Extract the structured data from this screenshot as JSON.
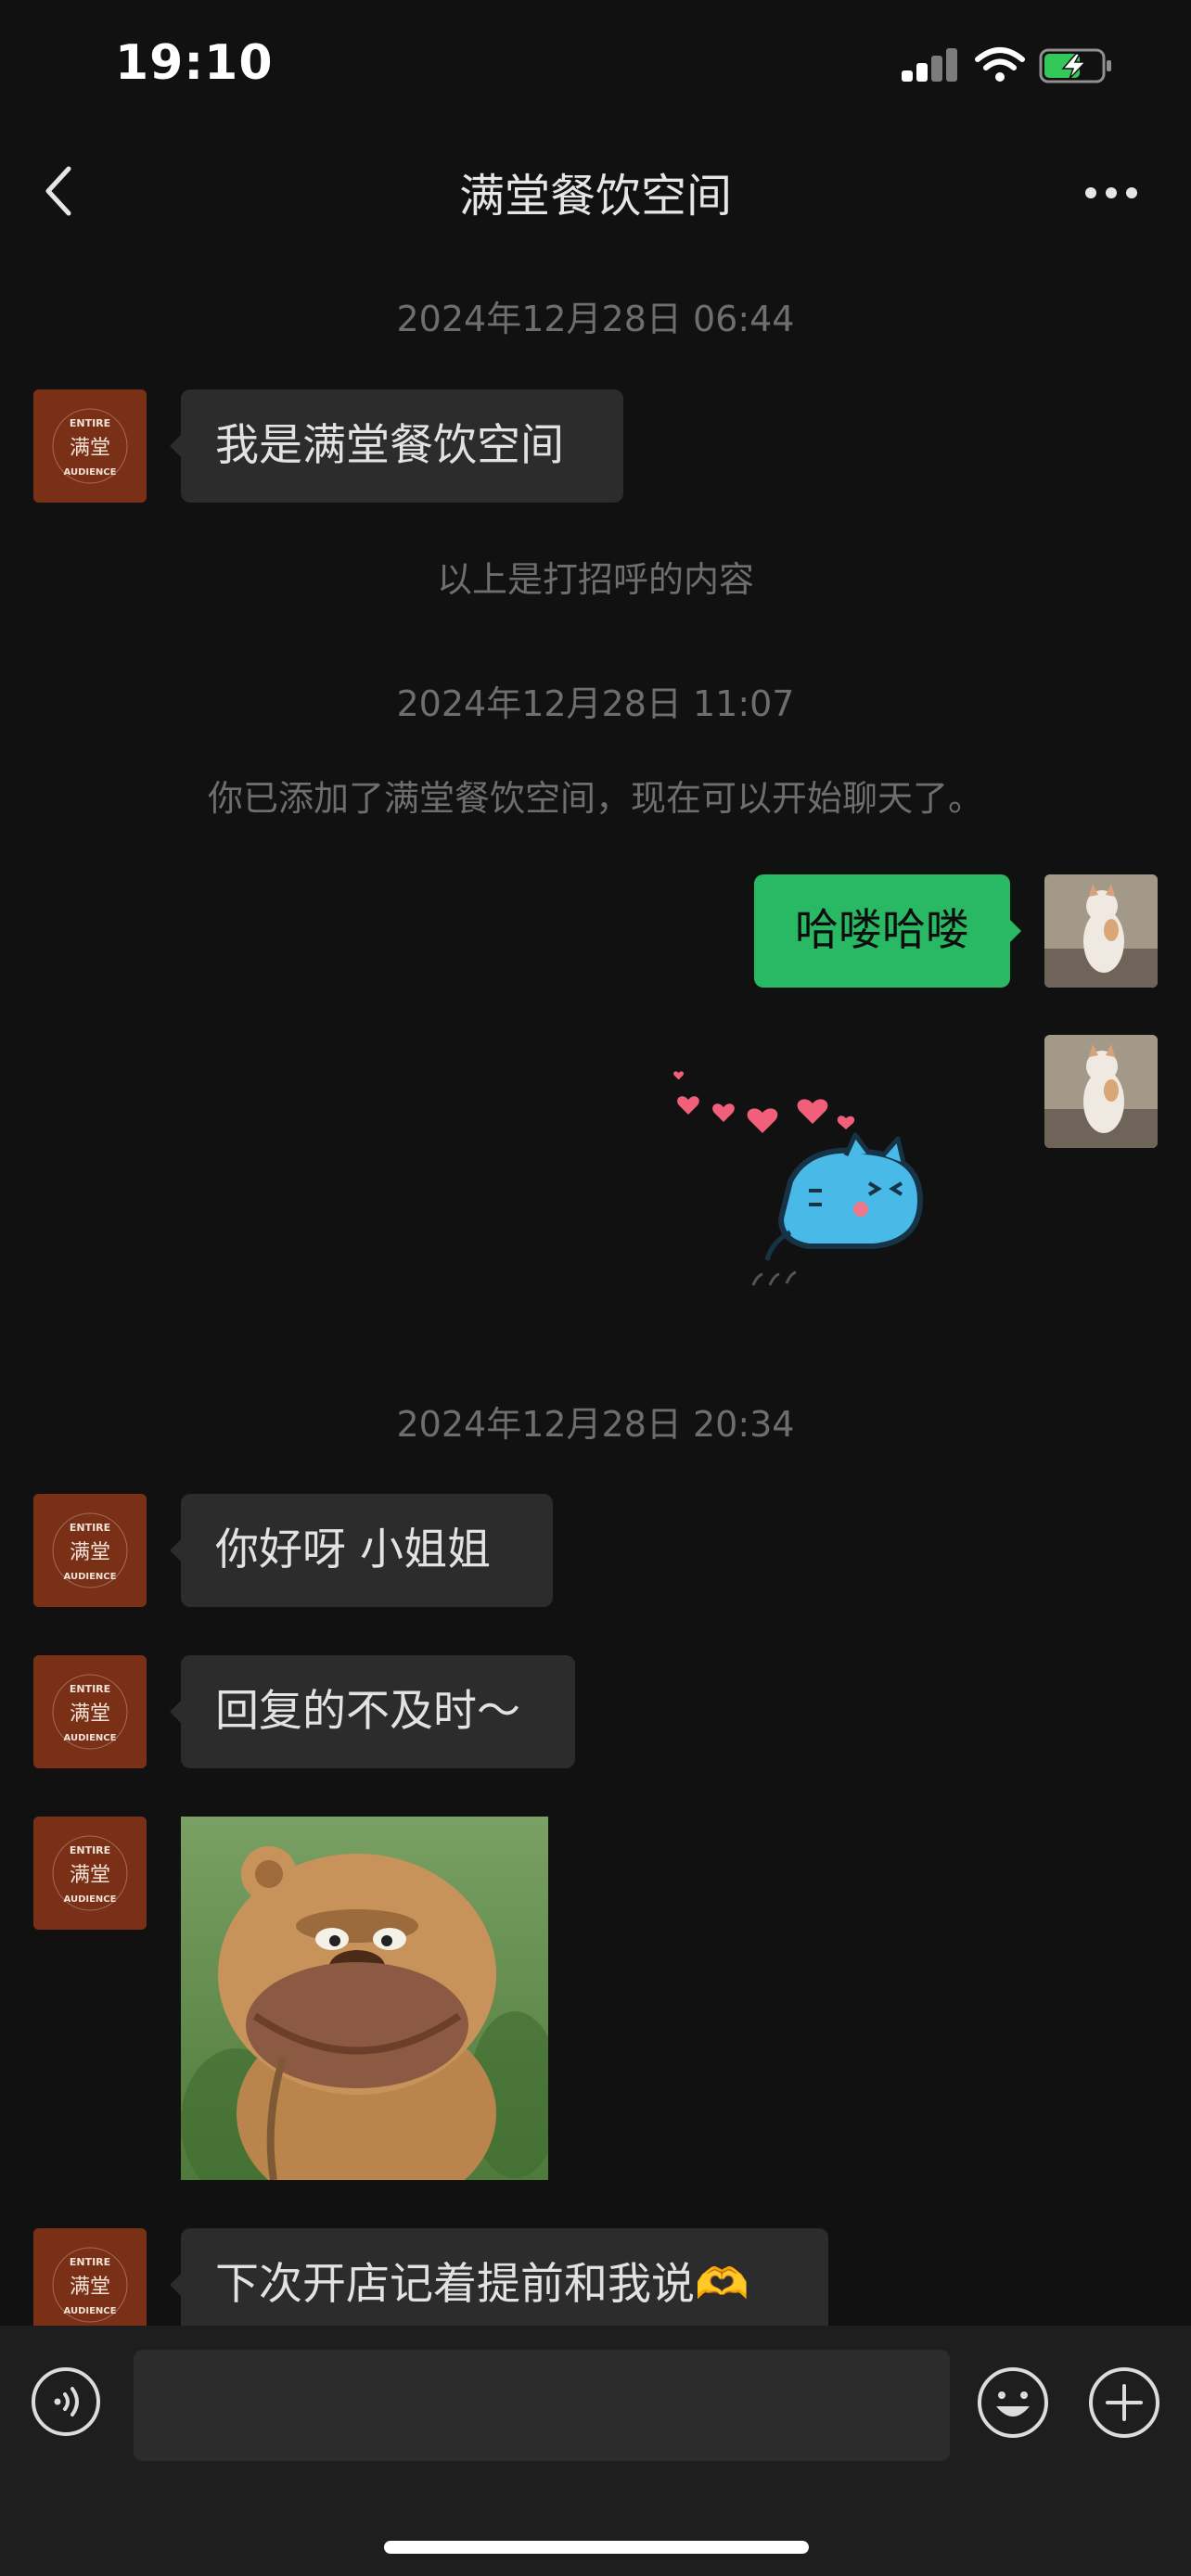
{
  "status_bar": {
    "time": "19:10"
  },
  "header": {
    "title": "满堂餐饮空间"
  },
  "messages": {
    "ts1": "2024年12月28日 06:44",
    "m1": "我是满堂餐饮空间",
    "greet_note": "以上是打招呼的内容",
    "ts2": "2024年12月28日 11:07",
    "added_note": "你已添加了满堂餐饮空间，现在可以开始聊天了。",
    "m2": "哈喽哈喽",
    "ts3": "2024年12月28日 20:34",
    "m3": "你好呀 小姐姐",
    "m4": "回复的不及时～",
    "m5": "下次开店记着提前和我说🫶"
  },
  "avatar_text": {
    "top": "ENTIRE",
    "center": "满堂",
    "bottom": "AUDIENCE"
  },
  "colors": {
    "background": "#111111",
    "incoming_bubble": "#2c2c2c",
    "outgoing_bubble": "#29b864",
    "avatar_brand": "#7a2f17"
  },
  "icons": {
    "back": "chevron-left-icon",
    "more": "more-dots-icon",
    "voice": "voice-icon",
    "emoji": "emoji-icon",
    "plus": "plus-icon"
  }
}
